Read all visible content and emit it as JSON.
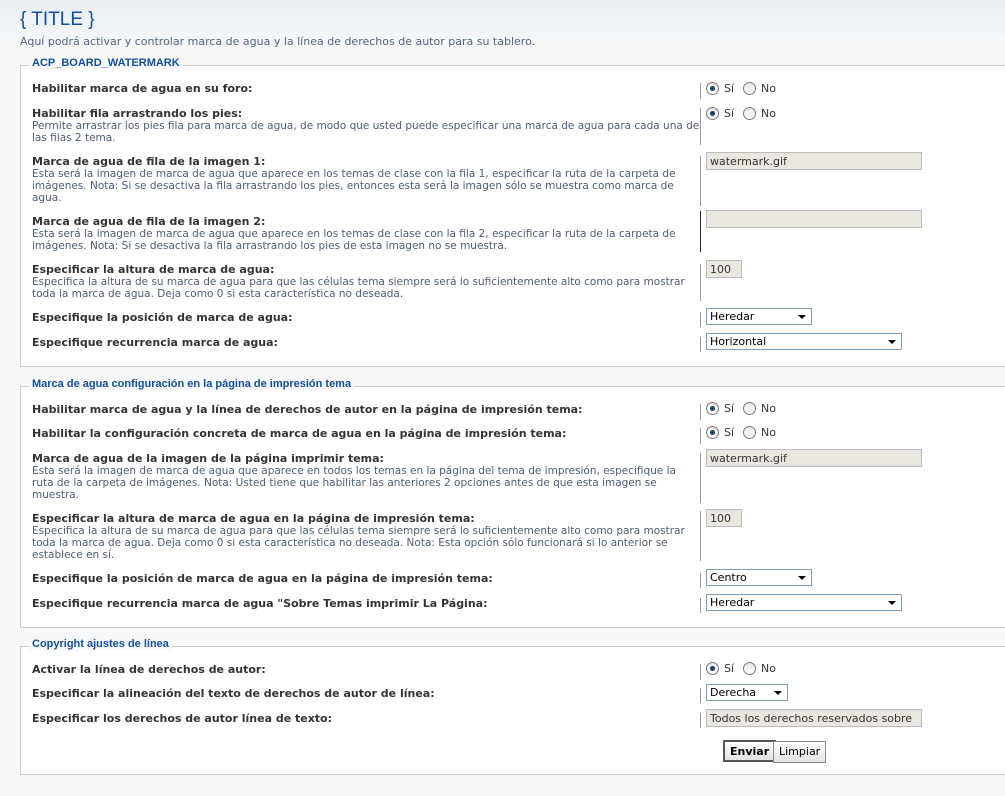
{
  "header": {
    "title": "{ TITLE }",
    "description": "Aquí podrá activar y controlar marca de agua y la línea de derechos de autor para su tablero."
  },
  "section1": {
    "legend": "ACP_BOARD_WATERMARK",
    "enable": {
      "title": "Habilitar marca de agua en su foro:",
      "yes": "Sí",
      "no": "No",
      "value": "Sí"
    },
    "drag": {
      "title": "Habilitar fila arrastrando los pies:",
      "desc": "Permite arrastrar los pies fila para marca de agua, de modo que usted puede especificar una marca de agua para cada una de las filas 2 tema.",
      "yes": "Sí",
      "no": "No",
      "value": "Sí"
    },
    "image1": {
      "title": "Marca de agua de fila de la imagen 1:",
      "desc": "Esta será la imagen de marca de agua que aparece en los temas de clase con la fila 1, especificar la ruta de la carpeta de imágenes. Nota: Si se desactiva la fila arrastrando los pies, entonces esta será la imagen sólo se muestra como marca de agua.",
      "value": "watermark.gif"
    },
    "image2": {
      "title": "Marca de agua de fila de la imagen 2:",
      "desc": "Esta será la imagen de marca de agua que aparece en los temas de clase con la fila 2, especificar la ruta de la carpeta de imágenes. Nota: Si se desactiva la fila arrastrando los pies de esta imagen no se muestra.",
      "value": ""
    },
    "height": {
      "title": "Especificar la altura de marca de agua:",
      "desc": "Especifica la altura de su marca de agua para que las células tema siempre será lo suficientemente alto como para mostrar toda la marca de agua. Deja como 0 si esta característica no deseada.",
      "value": "100"
    },
    "position": {
      "title": "Especifique la posición de marca de agua:",
      "value": "Heredar"
    },
    "repeat": {
      "title": "Especifique recurrencia marca de agua:",
      "value": "Horizontal"
    }
  },
  "section2": {
    "legend": "Marca de agua configuración en la página de impresión tema",
    "enable": {
      "title": "Habilitar marca de agua y la línea de derechos de autor en la página de impresión tema:",
      "yes": "Sí",
      "no": "No",
      "value": "Sí"
    },
    "specific": {
      "title": "Habilitar la configuración concreta de marca de agua en la página de impresión tema:",
      "yes": "Sí",
      "no": "No",
      "value": "Sí"
    },
    "image": {
      "title": "Marca de agua de la imagen de la página imprimir tema:",
      "desc": "Esta será la imagen de marca de agua que aparece en todos los temas en la página del tema de impresión, especifique la ruta de la carpeta de imágenes. Nota: Usted tiene que habilitar las anteriores 2 opciones antes de que esta imagen se muestra.",
      "value": "watermark.gif"
    },
    "height": {
      "title": "Especificar la altura de marca de agua en la página de impresión tema:",
      "desc": "Especifica la altura de su marca de agua para que las células tema siempre será lo suficientemente alto como para mostrar toda la marca de agua. Deja como 0 si esta característica no deseada. Nota: Esta opción sólo funcionará si lo anterior se establece en sí.",
      "value": "100"
    },
    "position": {
      "title": "Especifique la posición de marca de agua en la página de impresión tema:",
      "value": "Centro"
    },
    "repeat": {
      "title": "Especifique recurrencia marca de agua \"Sobre Temas imprimir La Página:",
      "value": "Heredar"
    }
  },
  "section3": {
    "legend": "Copyright ajustes de línea",
    "enable": {
      "title": "Activar la línea de derechos de autor:",
      "yes": "Sí",
      "no": "No",
      "value": "Sí"
    },
    "align": {
      "title": "Especificar la alineación del texto de derechos de autor de línea:",
      "value": "Derecha"
    },
    "text": {
      "title": "Especificar los derechos de autor línea de texto:",
      "value": "Todos los derechos reservados sobre"
    }
  },
  "buttons": {
    "submit": "Enviar",
    "reset": "Limpiar"
  }
}
